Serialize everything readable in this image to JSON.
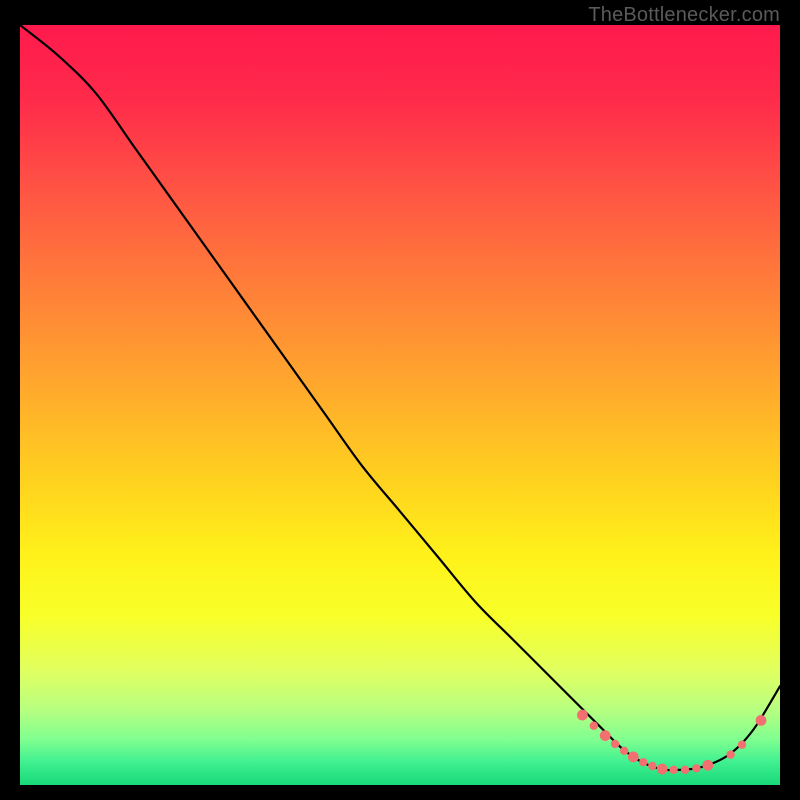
{
  "attribution": "TheBottlenecker.com",
  "gradient": {
    "stops": [
      {
        "offset": 0.0,
        "color": "#ff1a4d"
      },
      {
        "offset": 0.1,
        "color": "#ff2b4a"
      },
      {
        "offset": 0.22,
        "color": "#ff5544"
      },
      {
        "offset": 0.35,
        "color": "#ff8038"
      },
      {
        "offset": 0.48,
        "color": "#ffaa2c"
      },
      {
        "offset": 0.6,
        "color": "#ffd21f"
      },
      {
        "offset": 0.7,
        "color": "#fff21a"
      },
      {
        "offset": 0.78,
        "color": "#f8ff2a"
      },
      {
        "offset": 0.85,
        "color": "#e0ff60"
      },
      {
        "offset": 0.9,
        "color": "#b8ff80"
      },
      {
        "offset": 0.94,
        "color": "#80ff90"
      },
      {
        "offset": 0.97,
        "color": "#40f090"
      },
      {
        "offset": 1.0,
        "color": "#18d878"
      }
    ]
  },
  "chart_data": {
    "type": "line",
    "xlabel": "",
    "ylabel": "",
    "xlim": [
      0,
      100
    ],
    "ylim": [
      0,
      100
    ],
    "title": "",
    "series": [
      {
        "name": "bottleneck-curve",
        "x": [
          0,
          5,
          10,
          15,
          20,
          25,
          30,
          35,
          40,
          45,
          50,
          55,
          60,
          65,
          70,
          74,
          77,
          79,
          81,
          83,
          85,
          87,
          89,
          91,
          93,
          95,
          97,
          100
        ],
        "y": [
          100,
          96,
          91,
          84,
          77,
          70,
          63,
          56,
          49,
          42,
          36,
          30,
          24,
          19,
          14,
          10,
          7,
          5,
          3.5,
          2.5,
          2.0,
          2.0,
          2.2,
          2.8,
          3.8,
          5.5,
          8.0,
          13
        ]
      }
    ],
    "markers": {
      "name": "sample-points",
      "color": "#f2706f",
      "radius_small": 4.2,
      "radius_large": 5.4,
      "points": [
        {
          "x": 74.0,
          "y": 9.2,
          "r": "large"
        },
        {
          "x": 75.5,
          "y": 7.8,
          "r": "small"
        },
        {
          "x": 77.0,
          "y": 6.5,
          "r": "large"
        },
        {
          "x": 78.3,
          "y": 5.4,
          "r": "small"
        },
        {
          "x": 79.5,
          "y": 4.5,
          "r": "small"
        },
        {
          "x": 80.7,
          "y": 3.7,
          "r": "large"
        },
        {
          "x": 82.0,
          "y": 3.0,
          "r": "small"
        },
        {
          "x": 83.2,
          "y": 2.5,
          "r": "small"
        },
        {
          "x": 84.5,
          "y": 2.1,
          "r": "large"
        },
        {
          "x": 86.0,
          "y": 2.0,
          "r": "small"
        },
        {
          "x": 87.5,
          "y": 2.0,
          "r": "small"
        },
        {
          "x": 89.0,
          "y": 2.2,
          "r": "small"
        },
        {
          "x": 90.5,
          "y": 2.6,
          "r": "large"
        },
        {
          "x": 93.5,
          "y": 4.0,
          "r": "small"
        },
        {
          "x": 95.0,
          "y": 5.3,
          "r": "small"
        },
        {
          "x": 97.5,
          "y": 8.5,
          "r": "large"
        }
      ]
    }
  }
}
